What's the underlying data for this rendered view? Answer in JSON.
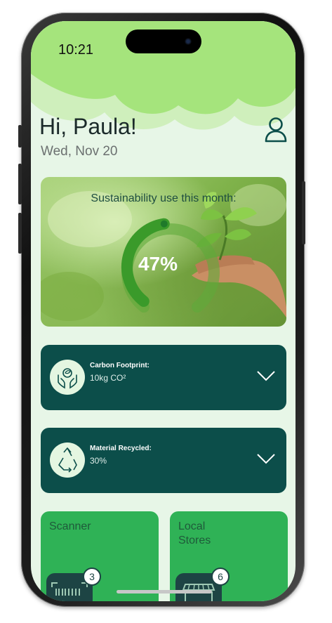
{
  "status_bar": {
    "time": "10:21"
  },
  "header": {
    "greeting": "Hi, Paula!",
    "date": "Wed, Nov 20"
  },
  "hero": {
    "title": "Sustainability use this month:",
    "percent_label": "47%",
    "progress_fraction": 0.47
  },
  "stats": [
    {
      "label": "Carbon Footprint:",
      "value": "10kg CO²",
      "icon": "hands-leaf-icon"
    },
    {
      "label": "Material Recycled:",
      "value": "30%",
      "icon": "recycle-icon"
    }
  ],
  "tiles": [
    {
      "label": "Scanner",
      "badge": "3",
      "icon": "barcode-scanner-icon"
    },
    {
      "label": "Local Stores",
      "badge": "6",
      "icon": "storefront-icon"
    }
  ],
  "colors": {
    "accent_green": "#2fb256",
    "dark_teal": "#0c4e4a",
    "light_bg": "#e7f6e7",
    "wave_green": "#a5e47c"
  }
}
